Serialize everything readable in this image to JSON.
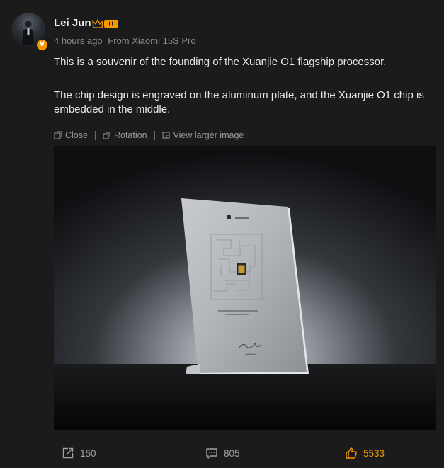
{
  "post": {
    "author": "Lei Jun",
    "verified_badge": "V",
    "time": "4 hours ago",
    "source": "From Xiaomi 15S Pro",
    "paragraphs": [
      "This is a souvenir of the founding of the Xuanjie O1 flagship processor.",
      "The chip design is engraved on the aluminum plate, and the Xuanjie O1 chip is embedded in the middle."
    ]
  },
  "image_toolbar": {
    "close_label": "Close",
    "rotation_label": "Rotation",
    "view_larger_label": "View larger image"
  },
  "footer": {
    "repost_count": "150",
    "comment_count": "805",
    "like_count": "5533"
  },
  "colors": {
    "background": "#1b1b1b",
    "accent": "#f39800",
    "muted_text": "#8a8a8a"
  },
  "icons": [
    "verified-v-icon",
    "rank-crown-icon",
    "close-icon",
    "rotation-icon",
    "view-larger-icon",
    "repost-icon",
    "comment-icon",
    "like-icon"
  ]
}
